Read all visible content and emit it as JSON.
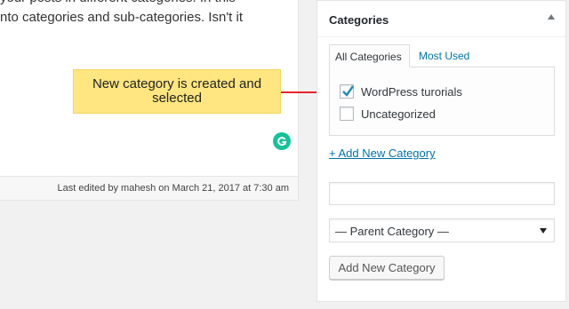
{
  "editor": {
    "lines": [
      "your posts in different categories. In this",
      "nto categories and sub-categories. Isn't it"
    ],
    "last_edited": "Last edited by mahesh on March 21, 2017 at 7:30 am"
  },
  "callout": {
    "text": "New category is created and selected",
    "color": "#ffe680",
    "arrow_color": "#e8232a"
  },
  "categories_box": {
    "title": "Categories",
    "tabs": [
      {
        "label": "All Categories",
        "active": true
      },
      {
        "label": "Most Used",
        "active": false
      }
    ],
    "items": [
      {
        "label": "WordPress turorials",
        "checked": true
      },
      {
        "label": "Uncategorized",
        "checked": false
      }
    ],
    "add_new_link": "+ Add New Category",
    "new_category_value": "",
    "parent_select": "— Parent Category —",
    "add_button": "Add New Category"
  }
}
